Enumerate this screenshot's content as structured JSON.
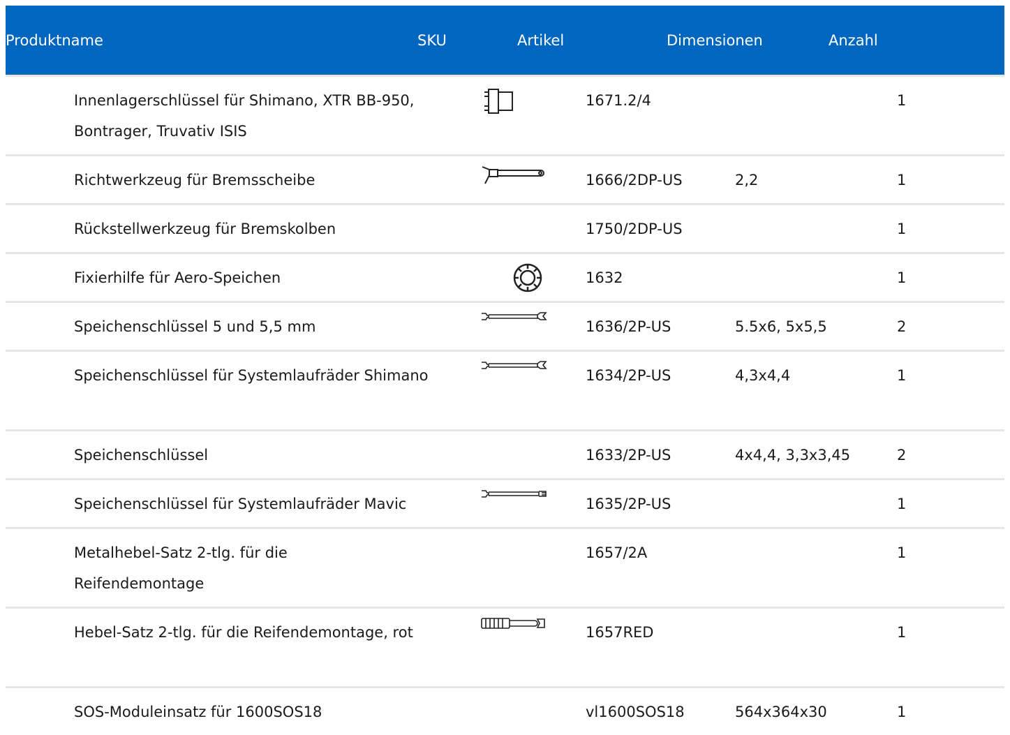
{
  "table": {
    "headers": {
      "name": "Produktname",
      "sku": "SKU",
      "article": "Artikel",
      "dimensions": "Dimensionen",
      "quantity": "Anzahl"
    },
    "rows": [
      {
        "name": "Innenlagerschlüssel für Shimano, XTR BB-950, Bontrager, Truvativ ISIS",
        "icon": "bottom-bracket-tool-icon",
        "article": "1671.2/4",
        "dimensions": "",
        "quantity": "1"
      },
      {
        "name": "Richtwerkzeug für Bremsscheibe",
        "icon": "disc-truing-tool-icon",
        "article": "1666/2DP-US",
        "dimensions": "2,2",
        "quantity": "1"
      },
      {
        "name": "Rückstellwerkzeug für Bremskolben",
        "icon": "",
        "article": "1750/2DP-US",
        "dimensions": "",
        "quantity": "1"
      },
      {
        "name": "Fixierhilfe für Aero-Speichen",
        "icon": "aero-spoke-holder-icon",
        "article": "1632",
        "dimensions": "",
        "quantity": "1"
      },
      {
        "name": "Speichenschlüssel 5 und 5,5 mm",
        "icon": "spoke-wrench-icon",
        "article": "1636/2P-US",
        "dimensions": "5.5x6, 5x5,5",
        "quantity": "2"
      },
      {
        "name": "Speichenschlüssel für Systemlaufräder Shimano",
        "icon": "spoke-wrench-icon",
        "article": "1634/2P-US",
        "dimensions": "4,3x4,4",
        "quantity": "1"
      },
      {
        "name": "Speichenschlüssel",
        "icon": "",
        "article": "1633/2P-US",
        "dimensions": "4x4,4, 3,3x3,45",
        "quantity": "2"
      },
      {
        "name": "Speichenschlüssel für Systemlaufräder Mavic",
        "icon": "mavic-spoke-wrench-icon",
        "article": "1635/2P-US",
        "dimensions": "",
        "quantity": "1"
      },
      {
        "name": "Metalhebel-Satz 2-tlg. für die Reifendemontage",
        "icon": "",
        "article": "1657/2A",
        "dimensions": "",
        "quantity": "1"
      },
      {
        "name": "Hebel-Satz 2-tlg. für die Reifendemontage, rot",
        "icon": "tire-lever-icon",
        "article": "1657RED",
        "dimensions": "",
        "quantity": "1"
      },
      {
        "name": "SOS-Moduleinsatz für 1600SOS18",
        "icon": "",
        "article": "vl1600SOS18",
        "dimensions": "564x364x30",
        "quantity": "1"
      }
    ]
  }
}
